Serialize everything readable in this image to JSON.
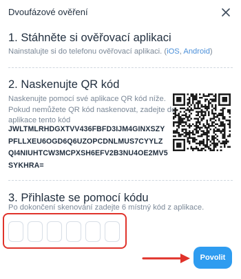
{
  "header": {
    "title": "Dvoufázové ověření"
  },
  "step1": {
    "title": "1. Stáhněte si ověřovací aplikaci",
    "desc_prefix": "Nainstalujte si do telefonu ověřovací aplikaci. (",
    "ios_link": "iOS",
    "sep": ", ",
    "android_link": "Android",
    "desc_suffix": ")"
  },
  "step2": {
    "title": "2. Naskenujte QR kód",
    "line1": "Naskenujte pomocí své aplikace QR kód níže.",
    "line2": "Pokud nemůžete QR kód naskenovat, zadejte do",
    "line3": "aplikace tento kód",
    "secret": "JWLTMLRHDGXTVV436FBFD3IJM4GINXSZYPFLLXEU6OGD6Q6UZOPCDNLMUS7CYYLZQI4NIUHTCW3MCPXSH6EFV2B3NU4OE2MV5SYKHRA="
  },
  "step3": {
    "title": "3. Přihlaste se pomocí kódu",
    "desc": "Po dokončení skenování zadejte 6 místný kód z aplikace.",
    "digit_count": 6
  },
  "footer": {
    "submit_label": "Povolit"
  },
  "icons": {
    "close": "close-icon",
    "qr": "qr-code",
    "arrow": "arrow-right-icon"
  },
  "colors": {
    "accent": "#2e9cf0",
    "highlight": "#e0322a",
    "link": "#4a8fd9"
  }
}
